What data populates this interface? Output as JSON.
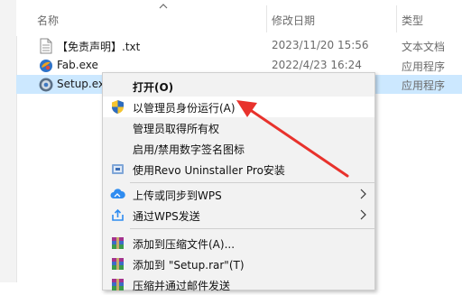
{
  "columns": {
    "name": "名称",
    "date": "修改日期",
    "type": "类型"
  },
  "files": [
    {
      "name": "【免责声明】.txt",
      "date": "2023/11/20 15:56",
      "type": "文本文档",
      "icon": "text-file-icon"
    },
    {
      "name": "Fab.exe",
      "date": "2022/4/23 16:24",
      "type": "应用程序",
      "icon": "fab-exe-icon"
    },
    {
      "name": "Setup.exe",
      "date": "",
      "type": "应用程序",
      "icon": "setup-exe-icon",
      "selected": true
    }
  ],
  "context_menu": {
    "items": [
      {
        "label": "打开(O)",
        "bold": true
      },
      {
        "label": "以管理员身份运行(A)",
        "icon": "uac-shield-icon",
        "highlighted": true
      },
      {
        "label": "管理员取得所有权"
      },
      {
        "label": "启用/禁用数字签名图标"
      },
      {
        "label": "使用Revo Uninstaller Pro安装",
        "icon": "revo-uninstaller-icon"
      },
      {
        "label": "上传或同步到WPS",
        "icon": "wps-cloud-icon",
        "submenu": true
      },
      {
        "label": "通过WPS发送",
        "icon": "wps-share-icon",
        "submenu": true
      },
      {
        "label": "添加到压缩文件(A)...",
        "icon": "winrar-icon"
      },
      {
        "label": "添加到 \"Setup.rar\"(T)",
        "icon": "winrar-icon"
      },
      {
        "label": "压缩并通过邮件发送",
        "icon": "winrar-icon"
      }
    ]
  },
  "colors": {
    "selection": "#cce8ff",
    "menu_bg": "#f2f2f2",
    "annotation_arrow": "#e8322c"
  }
}
